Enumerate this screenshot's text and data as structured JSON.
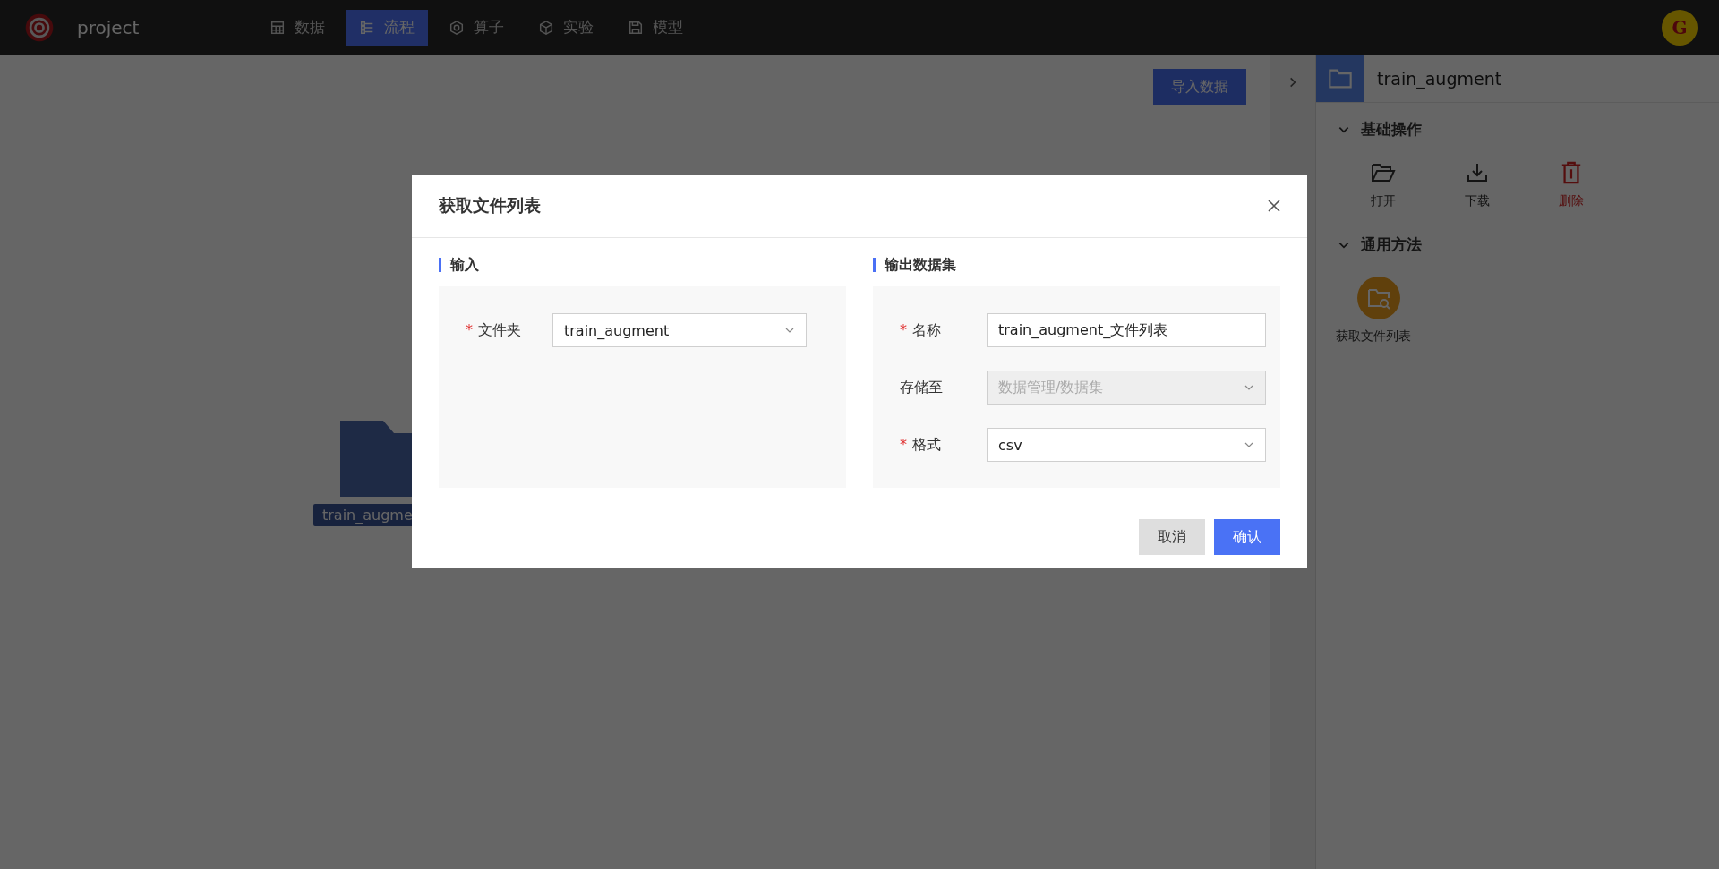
{
  "app": {
    "logo_text": "project",
    "avatar_letter": "G"
  },
  "nav": [
    {
      "label": "数据",
      "selected": false
    },
    {
      "label": "流程",
      "selected": true
    },
    {
      "label": "算子",
      "selected": false
    },
    {
      "label": "实验",
      "selected": false
    },
    {
      "label": "模型",
      "selected": false
    }
  ],
  "canvas": {
    "import_button": "导入数据",
    "folder_label": "train_augme"
  },
  "panel": {
    "title": "train_augment",
    "sections": [
      {
        "title": "基础操作",
        "expanded": true,
        "actions": [
          {
            "label": "打开",
            "kind": "normal"
          },
          {
            "label": "下载",
            "kind": "normal"
          },
          {
            "label": "删除",
            "kind": "danger"
          }
        ]
      },
      {
        "title": "通用方法",
        "expanded": true,
        "actions": [
          {
            "label": "获取文件列表",
            "kind": "method"
          }
        ]
      }
    ]
  },
  "dialog": {
    "title": "获取文件列表",
    "groups": [
      {
        "title": "输入",
        "fields": [
          {
            "mark": "*",
            "label": "文件夹",
            "kind": "select",
            "value": "train_augment",
            "disabled": false
          }
        ]
      },
      {
        "title": "输出数据集",
        "fields": [
          {
            "mark": "*",
            "label": "名称",
            "kind": "text",
            "value": "train_augment_文件列表",
            "disabled": false
          },
          {
            "label": "存储至",
            "kind": "select",
            "value": "数据管理/数据集",
            "disabled": true
          },
          {
            "mark": "*",
            "label": "格式",
            "kind": "select",
            "value": "csv",
            "disabled": false
          }
        ]
      }
    ],
    "buttons": [
      {
        "label": "取消",
        "primary": false
      },
      {
        "label": "确认",
        "primary": true
      }
    ]
  }
}
